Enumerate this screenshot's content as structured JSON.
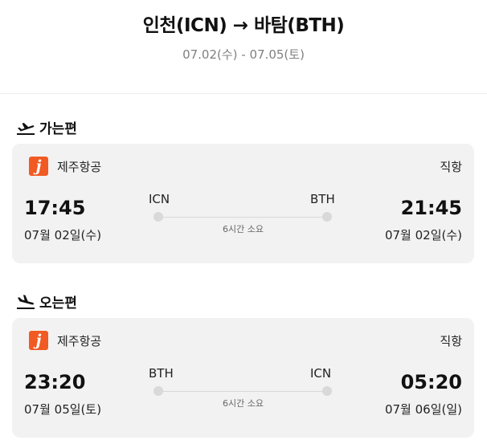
{
  "header": {
    "route_title": "인천(ICN) → 바탐(BTH)",
    "date_range": "07.02(수) - 07.05(토)"
  },
  "outbound": {
    "label": "가는편",
    "icon": "airplane-takeoff-icon",
    "airline_name": "제주항공",
    "airline_logo_letter": "j",
    "flight_type": "직항",
    "depart_time": "17:45",
    "depart_date": "07월 02일(수)",
    "from_code": "ICN",
    "to_code": "BTH",
    "duration": "6시간 소요",
    "arrive_time": "21:45",
    "arrive_date": "07월 02일(수)"
  },
  "inbound": {
    "label": "오는편",
    "icon": "airplane-landing-icon",
    "airline_name": "제주항공",
    "airline_logo_letter": "j",
    "flight_type": "직항",
    "depart_time": "23:20",
    "depart_date": "07월 05일(토)",
    "from_code": "BTH",
    "to_code": "ICN",
    "duration": "6시간 소요",
    "arrive_time": "05:20",
    "arrive_date": "07월 06일(일)"
  },
  "colors": {
    "airline_brand": "#f15a22",
    "card_background": "#f2f2f2",
    "muted_text": "#808080"
  }
}
